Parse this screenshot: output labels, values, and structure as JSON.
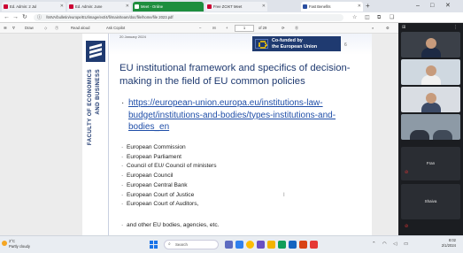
{
  "browser": {
    "tabs": [
      {
        "label": "Ed. Admin: 2 Jul",
        "state": "normal"
      },
      {
        "label": "Ed. Admin: June",
        "state": "normal"
      },
      {
        "label": "Meet - Online",
        "state": "meet"
      },
      {
        "label": "Free ZCIKT Meet",
        "state": "normal"
      },
      {
        "label": "Fast Benefits",
        "state": "active"
      }
    ],
    "new_tab_label": "+",
    "url": "\\\\MVA/bulletin/europe/EU/image/ext/4/fi/main/team/doc/file/home/file 2023.pdf",
    "window_controls": [
      "–",
      "□",
      "✕"
    ]
  },
  "pdf_toolbar": {
    "draw_label": "Draw",
    "document_name": "Read aloud",
    "ask_label": "Ask Copilot",
    "zoom_minus": "–",
    "zoom_plus": "+",
    "page_current": "1",
    "page_total": "of 29"
  },
  "slide": {
    "date": "20 January 2024",
    "eu_badge_line1": "Co-funded by",
    "eu_badge_line2": "the European Union",
    "page_number": "6",
    "sidebar_line1": "FACULTY OF ECONOMICS",
    "sidebar_line2": "AND BUSINESS",
    "title": "EU institutional framework and specifics of decision-making in the field of EU common policies",
    "link_bullet": "·",
    "link": "https://european-union.europa.eu/institutions-law-budget/institutions-and-bodies/types-institutions-and-bodies_en",
    "list": [
      "European Commission",
      "European Parliament",
      "Council of EU/ Council of ministers",
      "European Council",
      "European Central Bank",
      "European Court of Justice",
      "European Court of Auditors,"
    ],
    "last_line": "and other EU bodies, agencies, etc."
  },
  "call_panel": {
    "participants": [
      {
        "name": ""
      },
      {
        "name": ""
      },
      {
        "name": ""
      },
      {
        "name": ""
      }
    ],
    "tile_labels": [
      "Fran",
      "Shaiva"
    ]
  },
  "taskbar": {
    "weather_temp": "2°C",
    "weather_desc": "Partly cloudy",
    "search_placeholder": "Search",
    "time": "8:02",
    "date": "2/1/2024"
  },
  "colors": {
    "eu_blue": "#1f3a70",
    "link_blue": "#1f4ea8",
    "eu_gold": "#ffcc00",
    "meet_green": "#1e8e3e"
  },
  "icons": {
    "back": "back-arrow-icon",
    "forward": "forward-arrow-icon",
    "refresh": "refresh-icon",
    "start": "windows-start-icon"
  }
}
